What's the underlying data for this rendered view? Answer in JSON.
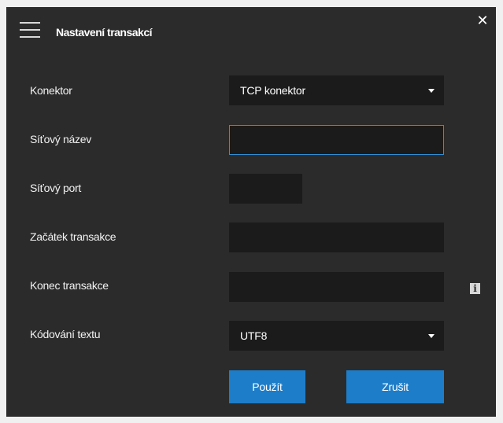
{
  "dialog": {
    "title": "Nastavení transakcí",
    "menu_icon": "hamburger-menu-icon",
    "close_icon": "close-icon",
    "close_glyph": "✕"
  },
  "form": {
    "connector": {
      "label": "Konektor",
      "value": "TCP konektor"
    },
    "network_name": {
      "label": "Síťový název",
      "value": ""
    },
    "network_port": {
      "label": "Síťový port",
      "value": ""
    },
    "transaction_start": {
      "label": "Začátek transakce",
      "value": ""
    },
    "transaction_end": {
      "label": "Konec transakce",
      "value": "",
      "info_icon": "info-icon",
      "info_glyph": "i"
    },
    "text_encoding": {
      "label": "Kódování textu",
      "value": "UTF8"
    }
  },
  "buttons": {
    "apply": "Použít",
    "cancel": "Zrušit"
  },
  "colors": {
    "background": "#2b2b2b",
    "field_background": "#1b1b1b",
    "focus_border": "#2e8fd6",
    "button": "#1e7dc8"
  }
}
